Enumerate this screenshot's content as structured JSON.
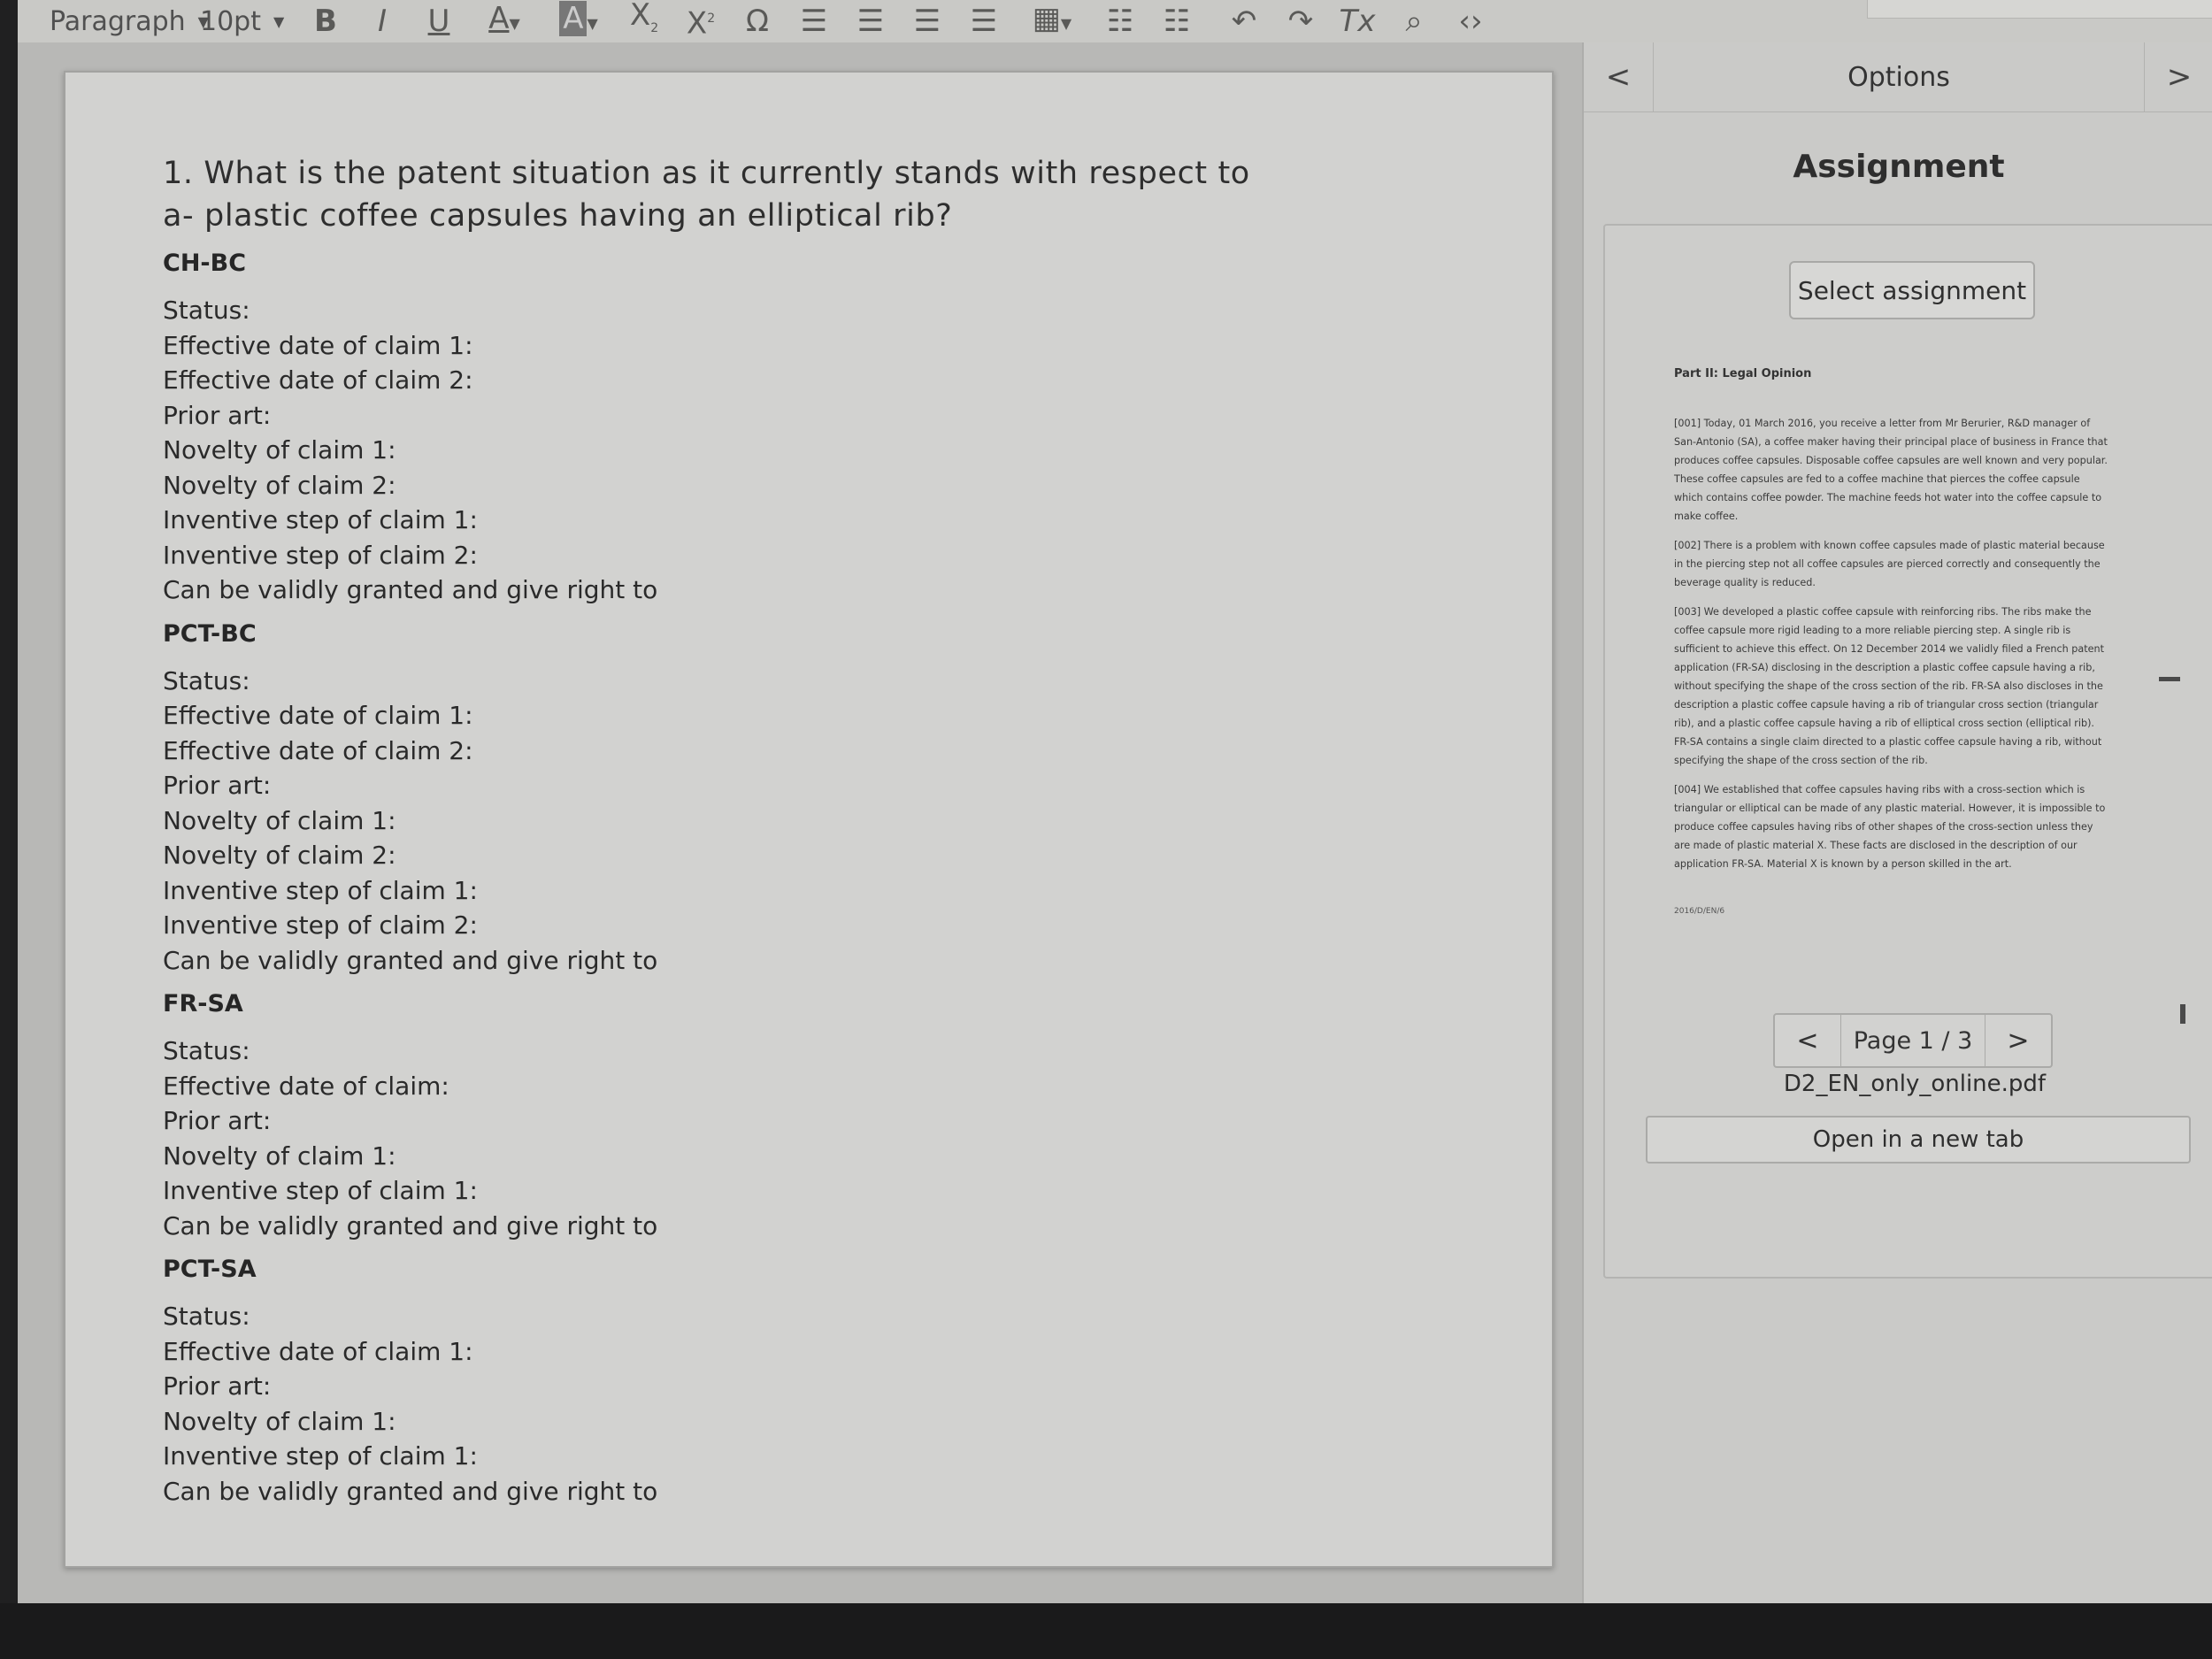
{
  "toolbar": {
    "format_select": "Paragraph",
    "size_select": "10pt",
    "icons": [
      "bold",
      "italic",
      "underline",
      "text-color",
      "highlight-color",
      "subscript",
      "superscript",
      "special-char",
      "align-left",
      "align-center",
      "align-right",
      "align-justify",
      "table",
      "bullet-list",
      "numbered-list",
      "undo",
      "redo",
      "clear-format",
      "find-replace",
      "source-code"
    ]
  },
  "editor": {
    "question": [
      "1. What is the patent situation as it currently stands with respect to",
      "a- plastic coffee capsules having an elliptical rib?"
    ],
    "sections": [
      {
        "heading": "CH-BC",
        "lines": [
          "Status:",
          "Effective date of claim 1:",
          "Effective date of claim 2:",
          "Prior art:",
          "Novelty of claim 1:",
          "Novelty of claim 2:",
          "Inventive step of claim 1:",
          "Inventive step of claim 2:",
          "Can be validly granted and give right to"
        ]
      },
      {
        "heading": "PCT-BC",
        "lines": [
          "Status:",
          "Effective date of claim 1:",
          "Effective date of claim 2:",
          "Prior art:",
          "Novelty of claim 1:",
          "Novelty of claim 2:",
          "Inventive step of claim 1:",
          "Inventive step of claim 2:",
          "Can be validly granted and give right to"
        ]
      },
      {
        "heading": "FR-SA",
        "lines": [
          "Status:",
          "Effective date of claim:",
          "Prior art:",
          "Novelty of claim 1:",
          "Inventive step of claim 1:",
          "Can be validly granted and give right to"
        ]
      },
      {
        "heading": "PCT-SA",
        "lines": [
          "Status:",
          "Effective date of claim 1:",
          "Prior art:",
          "Novelty of claim 1:",
          "Inventive step of claim 1:",
          "Can be validly granted and give right to"
        ]
      }
    ]
  },
  "panel": {
    "title": "Options",
    "nav_prev": "<",
    "nav_next": ">",
    "assignment_title": "Assignment",
    "select_button": "Select assignment",
    "pdf": {
      "heading": "Part II: Legal Opinion",
      "paragraphs": [
        "[001] Today, 01 March 2016, you receive a letter from Mr Berurier, R&D manager of San-Antonio (SA), a coffee maker having their principal place of business in France that produces coffee capsules. Disposable coffee capsules are well known and very popular. These coffee capsules are fed to a coffee machine that pierces the coffee capsule which contains coffee powder. The machine feeds hot water into the coffee capsule to make coffee.",
        "[002] There is a problem with known coffee capsules made of plastic material because in the piercing step not all coffee capsules are pierced correctly and consequently the beverage quality is reduced.",
        "[003] We developed a plastic coffee capsule with reinforcing ribs. The ribs make the coffee capsule more rigid leading to a more reliable piercing step. A single rib is sufficient to achieve this effect. On 12 December 2014 we validly filed a French patent application (FR-SA) disclosing in the description a plastic coffee capsule having a rib, without specifying the shape of the cross section of the rib. FR-SA also discloses in the description a plastic coffee capsule having a rib of triangular cross section (triangular rib), and a plastic coffee capsule having a rib of elliptical cross section (elliptical rib). FR-SA contains a single claim directed to a plastic coffee capsule having a rib, without specifying the shape of the cross section of the rib.",
        "[004] We established that coffee capsules having ribs with a cross-section which is triangular or elliptical can be made of any plastic material. However, it is impossible to produce coffee capsules having ribs of other shapes of the cross-section unless they are made of plastic material X. These facts are disclosed in the description of our application FR-SA. Material X is known by a person skilled in the art."
      ],
      "footer": "2016/D/EN/6"
    },
    "pager": {
      "prev": "<",
      "label": "Page 1 / 3",
      "next": ">"
    },
    "filename": "D2_EN_only_online.pdf",
    "open_button": "Open in a new tab"
  }
}
